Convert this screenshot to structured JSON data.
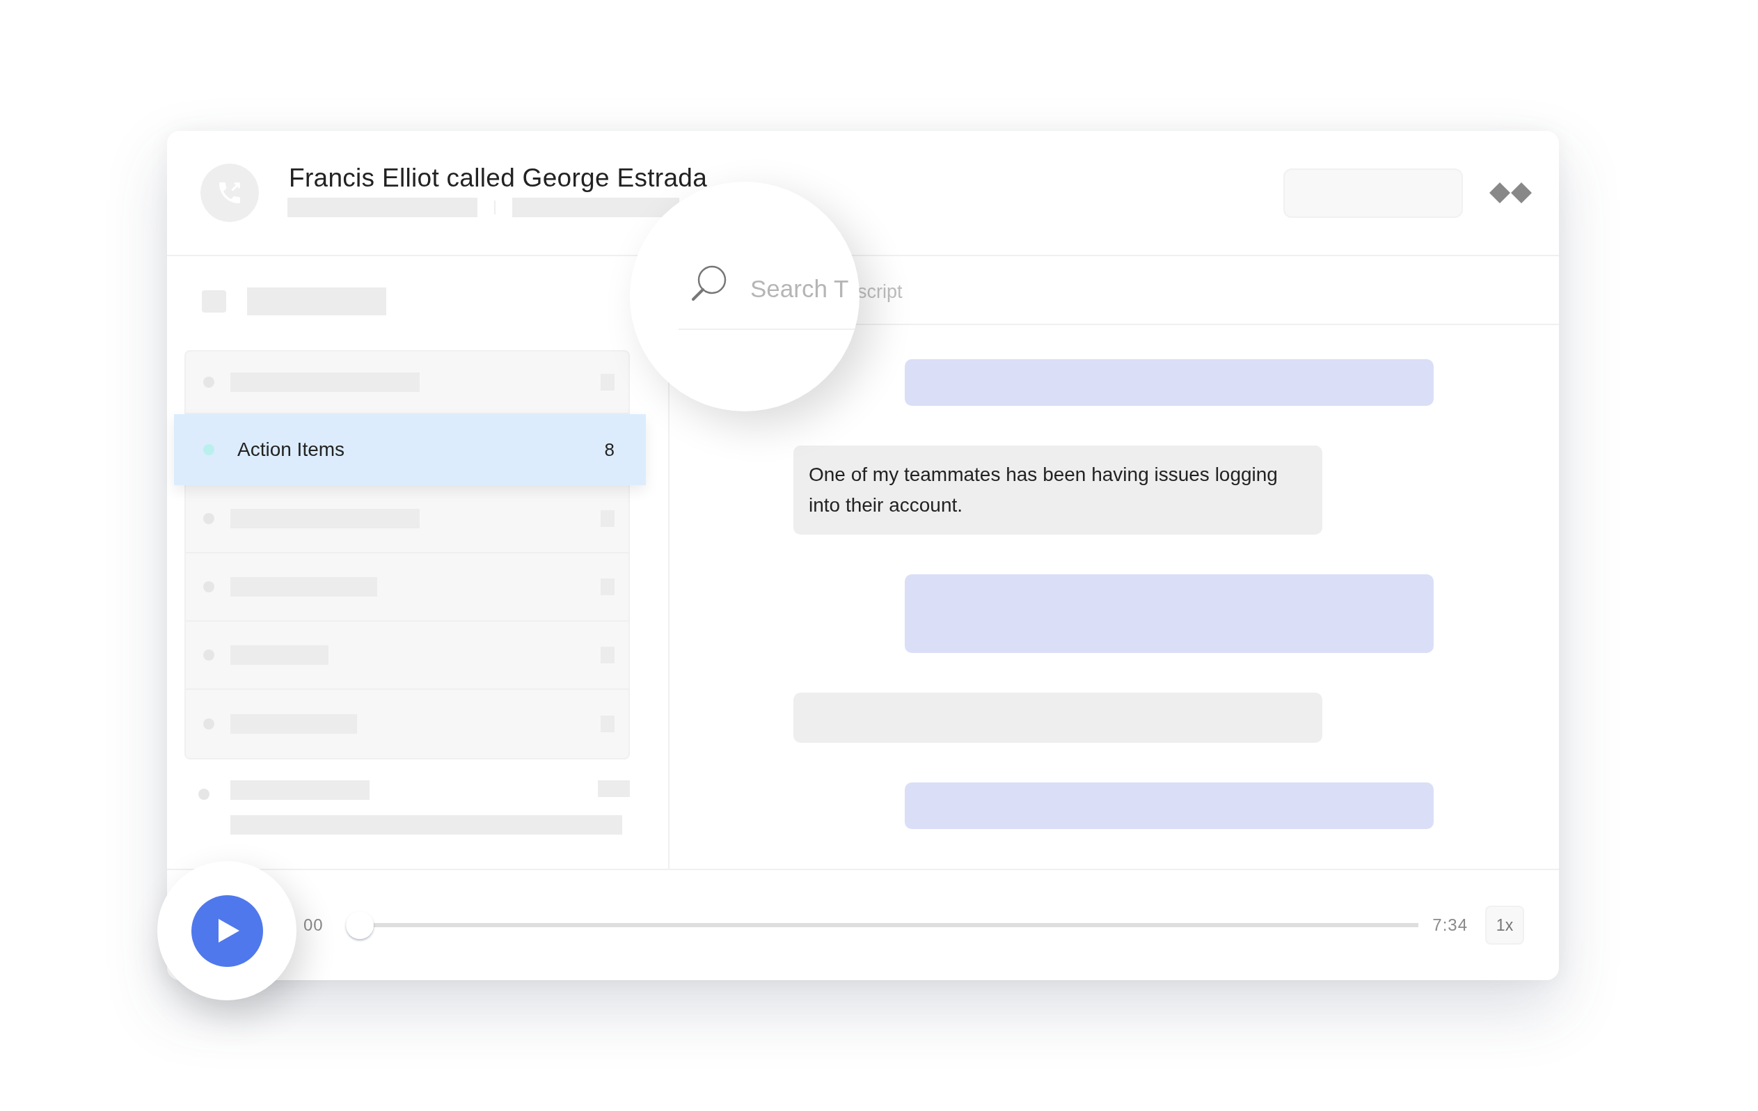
{
  "call": {
    "title": "Francis Elliot called George Estrada"
  },
  "sidebar": {
    "select_all": {
      "checked": false
    },
    "items": [
      {
        "selected": false
      },
      {
        "label": "Action Items",
        "count": "8",
        "color": "#b9f0ee",
        "selected": true
      },
      {
        "selected": false
      },
      {
        "selected": false
      },
      {
        "selected": false
      },
      {
        "selected": false
      }
    ]
  },
  "search": {
    "magnified_text": "Search T",
    "placeholder": "script"
  },
  "transcript": [
    {
      "kind": "agent"
    },
    {
      "kind": "customer",
      "text": "One of my teammates has been having issues logging into their account."
    },
    {
      "kind": "agent"
    },
    {
      "kind": "customer"
    },
    {
      "kind": "agent"
    }
  ],
  "player": {
    "elapsed": "00",
    "duration": "7:34",
    "speed": "1x",
    "level": 0
  }
}
